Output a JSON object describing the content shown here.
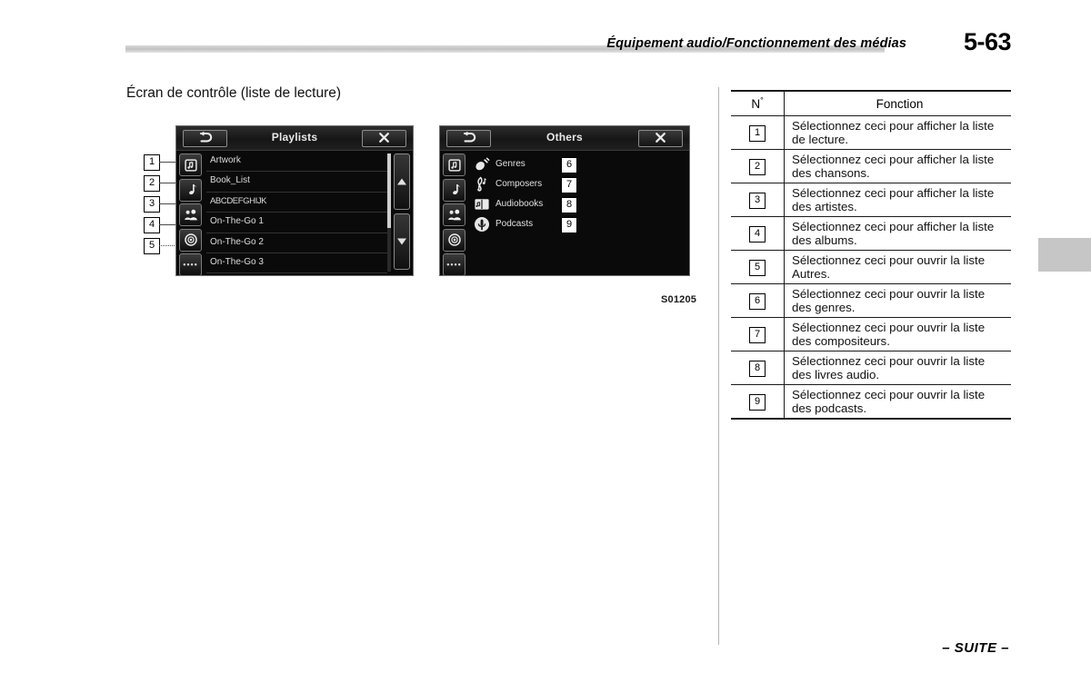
{
  "header": {
    "title": "Équipement audio/Fonctionnement des médias",
    "page_number": "5-63"
  },
  "section": {
    "heading": "Écran de contrôle (liste de lecture)"
  },
  "figure": {
    "code": "S01205",
    "callouts": [
      "1",
      "2",
      "3",
      "4",
      "5"
    ],
    "screen_playlists": {
      "title": "Playlists",
      "back_icon": "back-arrow-icon",
      "close_icon": "close-x-icon",
      "rail_icons": [
        "playlist-icon",
        "song-note-icon",
        "artist-people-icon",
        "album-disc-icon",
        "others-dots-icon"
      ],
      "rows": [
        "Artwork",
        "Book_List",
        "ABCDEFGHIJK",
        "On-The-Go 1",
        "On-The-Go 2",
        "On-The-Go 3"
      ],
      "scroll_up_icon": "scroll-up-arrow-icon",
      "scroll_down_icon": "scroll-down-arrow-icon"
    },
    "screen_others": {
      "title": "Others",
      "back_icon": "back-arrow-icon",
      "close_icon": "close-x-icon",
      "rail_icons": [
        "playlist-icon",
        "song-note-icon",
        "artist-people-icon",
        "album-disc-icon",
        "others-dots-icon"
      ],
      "items": [
        {
          "label": "Genres",
          "badge": "6",
          "icon": "guitar-icon"
        },
        {
          "label": "Composers",
          "badge": "7",
          "icon": "treble-clef-icon"
        },
        {
          "label": "Audiobooks",
          "badge": "8",
          "icon": "audiobook-icon"
        },
        {
          "label": "Podcasts",
          "badge": "9",
          "icon": "podcast-icon"
        }
      ]
    }
  },
  "table": {
    "columns": [
      "N °",
      "Fonction"
    ],
    "col_n_label": "N",
    "col_n_degree": "°",
    "col_f_label": "Fonction",
    "rows": [
      {
        "n": "1",
        "fonction": "Sélectionnez ceci pour afficher la liste de lecture."
      },
      {
        "n": "2",
        "fonction": "Sélectionnez ceci pour afficher la liste des chansons."
      },
      {
        "n": "3",
        "fonction": "Sélectionnez ceci pour afficher la liste des artistes."
      },
      {
        "n": "4",
        "fonction": "Sélectionnez ceci pour afficher la liste des albums."
      },
      {
        "n": "5",
        "fonction": "Sélectionnez ceci pour ouvrir la liste Autres."
      },
      {
        "n": "6",
        "fonction": "Sélectionnez ceci pour ouvrir la liste des genres."
      },
      {
        "n": "7",
        "fonction": "Sélectionnez ceci pour ouvrir la liste des compositeurs."
      },
      {
        "n": "8",
        "fonction": "Sélectionnez ceci pour ouvrir la liste des livres audio."
      },
      {
        "n": "9",
        "fonction": "Sélectionnez ceci pour ouvrir la liste des podcasts."
      }
    ]
  },
  "footer": {
    "continued": "– SUITE –"
  },
  "colors": {
    "rule_gray": "#c6c6c6",
    "screen_black": "#0a0a0a",
    "screen_text": "#e0e0e0",
    "ink": "#111111"
  }
}
